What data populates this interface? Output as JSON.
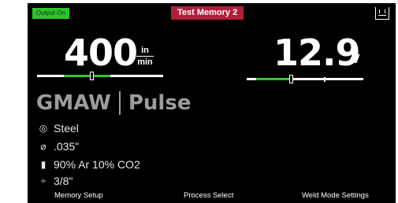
{
  "status": {
    "output": "Output On",
    "memory": "Test Memory 2"
  },
  "icons": {
    "output_terminal": "output-terminal-icon",
    "material": "spool-icon",
    "diameter": "diameter-icon",
    "gas": "gas-cylinder-icon",
    "thickness": "thickness-icon"
  },
  "wire_feed": {
    "value": "400",
    "unit_numerator": "in",
    "unit_denominator": "min",
    "range_start": 0.21,
    "range_end": 0.58,
    "position": 0.43
  },
  "voltage": {
    "value": "12.9",
    "unit": "V",
    "range_start": 0.08,
    "range_end": 0.38,
    "position": 0.38,
    "marker": 0.66
  },
  "process": {
    "type": "GMAW",
    "mode": "Pulse"
  },
  "settings": {
    "material": "Steel",
    "wire_diameter": ".035\"",
    "gas": "90% Ar 10% CO2",
    "thickness": "3/8\""
  },
  "footer": {
    "left": "Memory Setup",
    "center": "Process Select",
    "right": "Weld Mode Settings"
  },
  "colors": {
    "accent_green": "#2fc32f",
    "memory_red": "#b01f3a",
    "process_grey": "#9c9c9c"
  }
}
